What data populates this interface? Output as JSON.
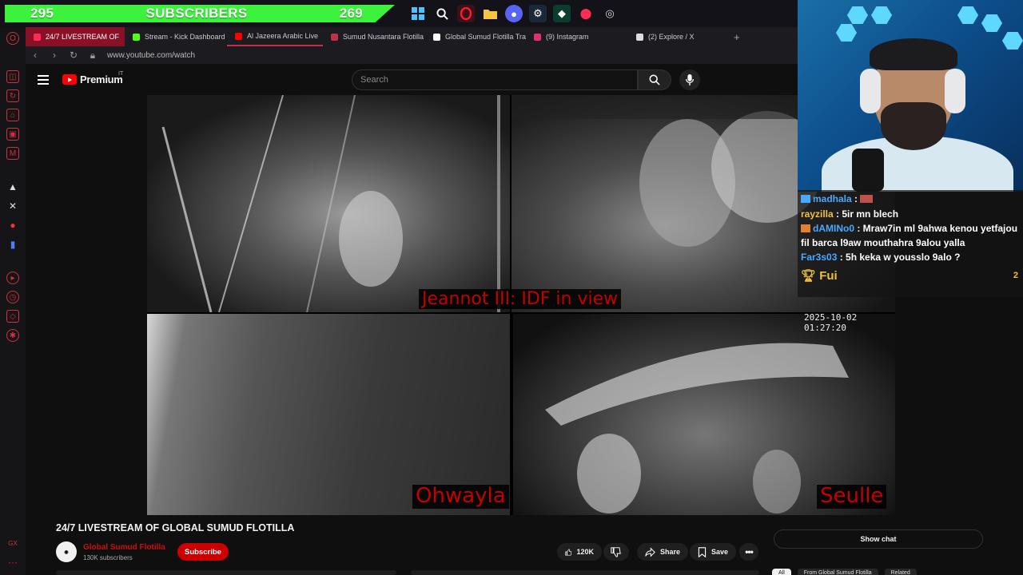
{
  "stream_overlay": {
    "sub_left": "295",
    "sub_label": "SUBSCRIBERS",
    "sub_right": "269"
  },
  "taskbar_icons": [
    "windows-icon",
    "search-icon",
    "opera-icon",
    "folder-icon",
    "discord-icon",
    "steam-icon",
    "app-icon",
    "maps-icon",
    "chrome-icon"
  ],
  "tabs": [
    {
      "label": "24/7 LIVESTREAM OF",
      "active": true,
      "color": "#ff2d55"
    },
    {
      "label": "Stream - Kick Dashboard",
      "active": false,
      "color": "#53fc18"
    },
    {
      "label": "Al Jazeera Arabic Live",
      "active": false,
      "color": "#ff0000"
    },
    {
      "label": "Sumud Nusantara Flotilla",
      "active": false,
      "color": "#c0304a"
    },
    {
      "label": "Global Sumud Flotilla Tra",
      "active": false,
      "color": "#ffffff"
    },
    {
      "label": "(9) Instagram",
      "active": false,
      "color": "#e1306c"
    },
    {
      "label": "(2) Explore / X",
      "active": false,
      "color": "#dddddd"
    }
  ],
  "address": {
    "url": "www.youtube.com/watch"
  },
  "youtube": {
    "brand": "Premium",
    "region": "IT",
    "search_placeholder": "Search"
  },
  "video": {
    "label_top": "Jeannot III: IDF in view",
    "label_bl": "Ohwayla",
    "label_br": "Seulle",
    "timestamp": "2025-10-02 01:27:20"
  },
  "chat": [
    {
      "user": "madhala",
      "message": "",
      "user_color": "#4aa8ff"
    },
    {
      "user": "rayzilla",
      "message": "5ir mn blech",
      "user_color": "#f0c040"
    },
    {
      "user": "dAMINo0",
      "message": "Mraw7in ml 9ahwa kenou yetfajou fil barca l9aw mouthahra 9alou yalla",
      "user_color": "#4aa8ff"
    },
    {
      "user": "Far3s03",
      "message": "5h keka w yousslo 9alo ?",
      "user_color": "#4aa8ff"
    }
  ],
  "chat_footer": {
    "name": "Fui",
    "count": "2"
  },
  "video_info": {
    "title": "24/7 LIVESTREAM OF GLOBAL SUMUD FLOTILLA",
    "channel": "Global Sumud Flotilla",
    "subscribers": "130K subscribers",
    "subscribe_label": "Subscribe",
    "likes": "120K",
    "share_label": "Share",
    "save_label": "Save",
    "show_chat_label": "Show chat"
  },
  "chips": [
    "All",
    "From Global Sumud Flotilla",
    "Related"
  ]
}
